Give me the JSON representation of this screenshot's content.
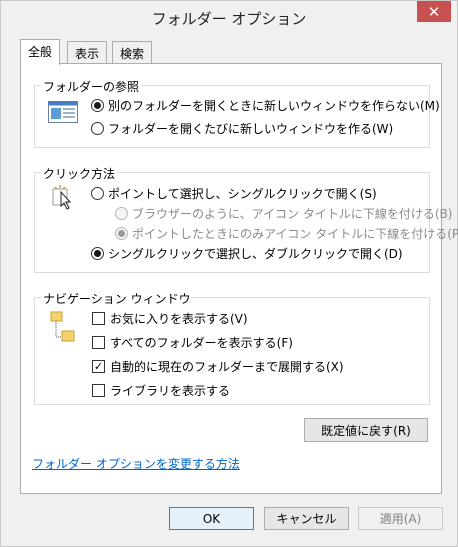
{
  "window": {
    "title": "フォルダー オプション",
    "close_glyph": "✕"
  },
  "tabs": [
    {
      "label": "全般",
      "active": true
    },
    {
      "label": "表示",
      "active": false
    },
    {
      "label": "検索",
      "active": false
    }
  ],
  "browse_group": {
    "label": "フォルダーの参照",
    "options": [
      {
        "label": "別のフォルダーを開くときに新しいウィンドウを作らない(M)",
        "checked": true
      },
      {
        "label": "フォルダーを開くたびに新しいウィンドウを作る(W)",
        "checked": false
      }
    ]
  },
  "click_group": {
    "label": "クリック方法",
    "options": [
      {
        "label": "ポイントして選択し、シングルクリックで開く(S)",
        "checked": false,
        "enabled": true
      },
      {
        "label": "ブラウザーのように、アイコン タイトルに下線を付ける(B)",
        "checked": false,
        "enabled": false
      },
      {
        "label": "ポイントしたときにのみアイコン タイトルに下線を付ける(P)",
        "checked": true,
        "enabled": false
      },
      {
        "label": "シングルクリックで選択し、ダブルクリックで開く(D)",
        "checked": true,
        "enabled": true
      }
    ]
  },
  "nav_group": {
    "label": "ナビゲーション ウィンドウ",
    "options": [
      {
        "label": "お気に入りを表示する(V)",
        "checked": false
      },
      {
        "label": "すべてのフォルダーを表示する(F)",
        "checked": false
      },
      {
        "label": "自動的に現在のフォルダーまで展開する(X)",
        "checked": true
      },
      {
        "label": "ライブラリを表示する",
        "checked": false
      }
    ]
  },
  "restore_button": "既定値に戻す(R)",
  "help_link": "フォルダー オプションを変更する方法",
  "footer": {
    "ok": "OK",
    "cancel": "キャンセル",
    "apply": "適用(A)"
  },
  "colors": {
    "accent": "#3c7fb1",
    "close": "#c75050",
    "link": "#0066cc"
  },
  "icons": {
    "browse": "window-layout-icon",
    "click": "cursor-click-icon",
    "nav": "folder-tree-icon"
  }
}
